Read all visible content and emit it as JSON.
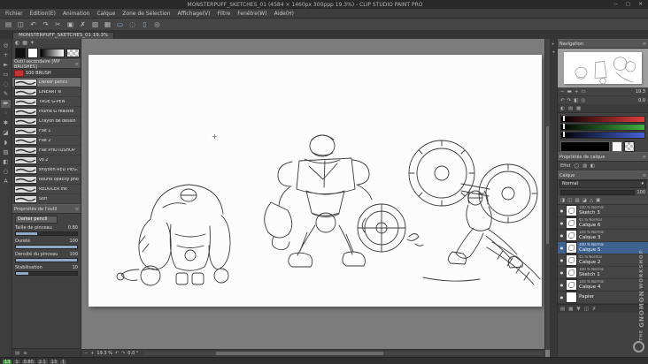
{
  "title_bar": {
    "title": "MONSTERPUFF_SKETCHES_01 (4584 × 1460px 300ppp 19.3%) - CLIP STUDIO PAINT PRO",
    "minimize": "—",
    "maximize": "▢",
    "close": "✕"
  },
  "menu_bar": {
    "items": [
      "Fichier",
      "Édition(E)",
      "Animation",
      "Calque",
      "Zone de Sélection",
      "Affichage(V)",
      "Filtre",
      "Fenêtre(W)",
      "Aide(H)"
    ]
  },
  "toolbar": {
    "icons": [
      {
        "n": "new-file-icon",
        "g": "▤"
      },
      {
        "n": "save-icon",
        "g": "◫"
      },
      {
        "n": "undo-icon",
        "g": "↶"
      },
      {
        "n": "redo-icon",
        "g": "↷"
      },
      {
        "n": "cut-icon",
        "g": "✂"
      },
      {
        "n": "copy-icon",
        "g": "▣"
      },
      {
        "n": "delete-icon",
        "g": "✗"
      },
      {
        "n": "fill-icon",
        "g": "▨"
      },
      {
        "n": "grid-icon",
        "g": "▦"
      },
      {
        "n": "selection-rect-icon",
        "g": "▭",
        "accent": true
      },
      {
        "n": "selection-lasso-icon",
        "g": "◌",
        "accent": true
      },
      {
        "n": "deselect-icon",
        "g": "▯",
        "accent": true
      },
      {
        "n": "zoom-mode-icon",
        "g": "◎"
      }
    ]
  },
  "tab_bar": {
    "document_tab": "MONSTERPUFF_SKETCHES_01  19.3%"
  },
  "tool_strip": {
    "tools": [
      {
        "n": "zoom-tool-icon",
        "g": "◎"
      },
      {
        "n": "move-tool-icon",
        "g": "+"
      },
      {
        "n": "operation-tool-icon",
        "g": "►"
      },
      {
        "n": "selection-tool-icon",
        "g": "▭"
      },
      {
        "n": "lasso-tool-icon",
        "g": "◌"
      },
      {
        "n": "pen-tool-icon",
        "g": "✎"
      },
      {
        "n": "pencil-tool-icon",
        "g": "✏",
        "selected": true
      },
      {
        "n": "airbrush-tool-icon",
        "g": "◦"
      },
      {
        "n": "decoration-tool-icon",
        "g": "✱"
      },
      {
        "n": "eraser-tool-icon",
        "g": "◪"
      },
      {
        "n": "blend-tool-icon",
        "g": "◗"
      },
      {
        "n": "fill-tool-icon",
        "g": "▨"
      },
      {
        "n": "gradient-tool-icon",
        "g": "◧"
      },
      {
        "n": "figure-tool-icon",
        "g": "○"
      },
      {
        "n": "text-tool-icon",
        "g": "A"
      }
    ]
  },
  "left_panel": {
    "mini_icons": [
      {
        "n": "color-wheel-icon",
        "g": "◐"
      },
      {
        "n": "color-set-icon",
        "g": "▦"
      },
      {
        "n": "eyedropper-icon",
        "g": "✦"
      }
    ],
    "colors": {
      "main": "#111111",
      "sub": "#ffffff"
    },
    "subtool": {
      "header": "Outil secondaire [MP BRUSHES]",
      "group": "100 BRUSH",
      "brushes": [
        {
          "name": "Darker pencil",
          "selected": true
        },
        {
          "name": "LINEART N"
        },
        {
          "name": "TRUE G-PEN"
        },
        {
          "name": "Plume G réaliste"
        },
        {
          "name": "Crayon de dessin"
        },
        {
          "name": "Flat 1"
        },
        {
          "name": "Flat 2"
        },
        {
          "name": "Flat PHOTOSHOP"
        },
        {
          "name": "vo 2"
        },
        {
          "name": "shiyoon RED PIEG. INK"
        },
        {
          "name": "Round opacity photoshop"
        },
        {
          "name": "REDUCER ink"
        },
        {
          "name": "Soft"
        }
      ]
    },
    "tool_property": {
      "header": "Propriétés de l'outil",
      "tool_name": "Darker pencil",
      "sliders": [
        {
          "label": "Taille de pinceau",
          "value": "0.80",
          "fill": "35"
        },
        {
          "label": "Dureté",
          "value": "100",
          "fill": "100"
        },
        {
          "label": "Densité du pinceau",
          "value": "100",
          "fill": "100"
        },
        {
          "label": "Stabilisation",
          "value": "10",
          "fill": "20"
        }
      ]
    },
    "bottom_icons": [
      {
        "n": "add-subtool-icon",
        "g": "▤"
      },
      {
        "n": "settings-icon",
        "g": "≡"
      }
    ]
  },
  "canvas": {
    "zoom": "19.3 %",
    "rotation": "0.0 °"
  },
  "dock_strip": {
    "icons": [
      {
        "n": "collapse-panels-icon",
        "g": "▸"
      },
      {
        "n": "expand-panels-icon",
        "g": "◂"
      }
    ]
  },
  "right_panel": {
    "navigator": {
      "title": "Navigation",
      "zoom_value": "19.3",
      "rotation_value": "0.0",
      "zoom_icons": [
        {
          "n": "zoom-out-icon",
          "g": "−"
        },
        {
          "n": "zoom-slider",
          "g": "▬"
        },
        {
          "n": "zoom-in-icon",
          "g": "+"
        },
        {
          "n": "fit-screen-icon",
          "g": "▭"
        }
      ],
      "rotate_icons": [
        {
          "n": "rotate-left-icon",
          "g": "↶"
        },
        {
          "n": "rotate-right-icon",
          "g": "↷"
        },
        {
          "n": "flip-horizontal-icon",
          "g": "◧"
        },
        {
          "n": "reset-view-icon",
          "g": "◎"
        }
      ]
    },
    "dock_tabs": [
      {
        "n": "color-wheel-tab-icon",
        "g": "◐"
      },
      {
        "n": "color-slider-tab-icon",
        "g": "▤"
      },
      {
        "n": "color-set-tab-icon",
        "g": "▦"
      }
    ],
    "color": {
      "red": "#e03c3c",
      "green": "#43b043",
      "blue": "#4662d8",
      "current": "#000000"
    },
    "layer_property": {
      "title": "Propriétés de calque",
      "effect_label": "Effet"
    },
    "layer_property_icons": [
      {
        "n": "border-effect-icon",
        "g": "◯"
      },
      {
        "n": "tone-effect-icon",
        "g": "▨"
      },
      {
        "n": "layer-color-effect-icon",
        "g": "◧"
      }
    ],
    "layers": {
      "title": "Calque",
      "blend_mode": "Normal",
      "opacity_value": "100",
      "toolbar": [
        {
          "n": "blend-mode-icon",
          "g": "◨"
        },
        {
          "n": "lock-layer-icon",
          "g": "◫"
        },
        {
          "n": "lock-transparency-icon",
          "g": "▨"
        },
        {
          "n": "mask-icon",
          "g": "◪"
        },
        {
          "n": "ruler-layer-icon",
          "g": "△"
        },
        {
          "n": "palette-icon",
          "g": "▣"
        }
      ],
      "items": [
        {
          "info": "100 % Normal",
          "name": "Sketch 3"
        },
        {
          "info": "45 % Normal",
          "name": "Calque 6"
        },
        {
          "info": "100 % Normal",
          "name": "Calque 3"
        },
        {
          "info": "100 % Normal",
          "name": "Calque 5",
          "selected": true
        },
        {
          "info": "45 % Normal",
          "name": "Calque 2"
        },
        {
          "info": "100 % Normal",
          "name": "Sketch 1"
        },
        {
          "info": "100 % Normal",
          "name": "Calque 4"
        },
        {
          "info": "",
          "name": "Papier",
          "plain": true
        }
      ],
      "bottom_icons": [
        {
          "n": "new-layer-icon",
          "g": "▤"
        },
        {
          "n": "new-folder-icon",
          "g": "▦"
        },
        {
          "n": "merge-down-icon",
          "g": "▼"
        },
        {
          "n": "transfer-icon",
          "g": "◫"
        },
        {
          "n": "delete-layer-icon",
          "g": "✗"
        }
      ]
    }
  },
  "status_bar": {
    "chips": [
      {
        "v": "13",
        "accent": true
      },
      {
        "v": "1"
      },
      {
        "v": "0.80"
      },
      {
        "v": "2.1"
      },
      {
        "v": "13"
      },
      {
        "v": "1"
      }
    ]
  },
  "watermark": {
    "the": "THE",
    "gnomon": "GNOMON",
    "workshop": "WORKSHOP"
  }
}
